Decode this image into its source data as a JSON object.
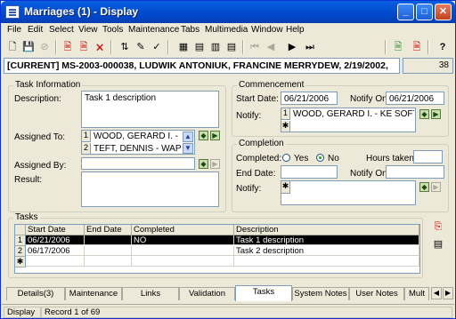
{
  "window": {
    "title": "Marriages (1) - Display",
    "min": "_",
    "max": "□",
    "close": "✕"
  },
  "menu": [
    "File",
    "Edit",
    "Select",
    "View",
    "Tools",
    "Maintenance",
    "Tabs",
    "Multimedia",
    "Window",
    "Help"
  ],
  "toolbar": {
    "icons": [
      "new-icon",
      "save-icon",
      "cancel-icon",
      "copy-record-icon",
      "copy-record-icon",
      "delete-icon",
      "sort-icon",
      "edit-icon",
      "spell-icon",
      "grid-view-icon",
      "form-view-icon",
      "list-view-icon",
      "first-icon",
      "prev-icon",
      "next-icon",
      "last-icon",
      "document-icon",
      "export-icon",
      "help-icon"
    ],
    "glyphs": {
      "first": "⏮",
      "prev": "◀",
      "next": "▶",
      "last": "⏭",
      "help": "?"
    }
  },
  "record": {
    "header": "[CURRENT] MS-2003-000038, LUDWIK ANTONIUK, FRANCINE MERRYDEW, 2/19/2002,",
    "number": "38"
  },
  "task_info": {
    "legend": "Task Information",
    "description_label": "Description:",
    "description": "Task 1 description",
    "assigned_to_label": "Assigned To:",
    "assigned_to": [
      {
        "row": "1",
        "name": "WOOD, GERARD I. - KE"
      },
      {
        "row": "2",
        "name": "TEFT, DENNIS - WAPPN"
      }
    ],
    "assigned_by_label": "Assigned By:",
    "assigned_by": "",
    "result_label": "Result:",
    "result": ""
  },
  "commencement": {
    "legend": "Commencement",
    "start_date_label": "Start Date:",
    "start_date": "06/21/2006",
    "notify_on_label": "Notify On:",
    "notify_on": "06/21/2006",
    "notify_label": "Notify:",
    "notify": [
      {
        "row": "1",
        "name": "WOOD, GERARD I. - KE SOFTWA."
      }
    ],
    "new_row_marker": "✱"
  },
  "completion": {
    "legend": "Completion",
    "completed_label": "Completed:",
    "yes_label": "Yes",
    "no_label": "No",
    "completed_value": "No",
    "hours_taken_label": "Hours taken:",
    "hours_taken": "",
    "end_date_label": "End Date:",
    "end_date": "",
    "notify_on_label": "Notify On:",
    "notify_on": "",
    "notify_label": "Notify:",
    "new_row_marker": "✱"
  },
  "tasks": {
    "legend": "Tasks",
    "columns": [
      "Start Date",
      "End Date",
      "Completed",
      "Description"
    ],
    "rows": [
      {
        "row": "1",
        "start_date": "06/21/2006",
        "end_date": "",
        "completed": "NO",
        "description": "Task 1 description",
        "selected": true
      },
      {
        "row": "2",
        "start_date": "06/17/2006",
        "end_date": "",
        "completed": "",
        "description": "Task 2 description",
        "selected": false
      }
    ],
    "new_row_marker": "✱"
  },
  "tabs": [
    {
      "label": "Details(3)",
      "active": false
    },
    {
      "label": "Maintenance",
      "active": false
    },
    {
      "label": "Links",
      "active": false
    },
    {
      "label": "Validation",
      "active": false
    },
    {
      "label": "Tasks",
      "active": true
    },
    {
      "label": "System Notes",
      "active": false
    },
    {
      "label": "User Notes",
      "active": false
    },
    {
      "label": "Mult",
      "active": false
    }
  ],
  "tab_arrows": {
    "left": "◀",
    "right": "▶"
  },
  "status": {
    "mode": "Display",
    "record": "Record 1 of 69"
  },
  "colors": {
    "title_blue": "#0453d8",
    "selection": "#000000",
    "panel": "#ece9d8"
  }
}
